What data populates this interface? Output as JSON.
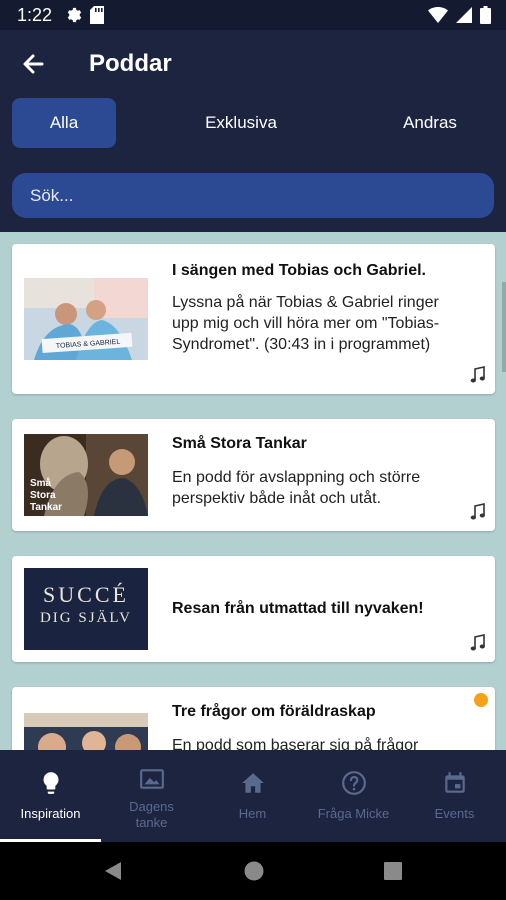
{
  "status_bar": {
    "time": "1:22",
    "left_icons": [
      "gear-icon",
      "sd-card-icon"
    ],
    "right_icons": [
      "wifi-icon",
      "signal-icon",
      "battery-icon"
    ]
  },
  "app_bar": {
    "title": "Poddar",
    "back_icon": "arrow-left-icon"
  },
  "tabs": [
    {
      "label": "Alla",
      "active": true
    },
    {
      "label": "Exklusiva",
      "active": false
    },
    {
      "label": "Andras",
      "active": false
    }
  ],
  "search": {
    "placeholder": "Sök..."
  },
  "podcasts": [
    {
      "title": "I sängen med Tobias och Gabriel.",
      "description": "Lyssna på när Tobias & Gabriel ringer upp mig och vill höra mer om \"Tobias-Syndromet\". (30:43 in i programmet)",
      "thumbnail_text": "TOBIAS & GABRIEL",
      "icon": "music-note-icon"
    },
    {
      "title": "Små Stora Tankar",
      "description": "En podd för avslappning och större perspektiv både inåt och utåt.",
      "thumbnail_text": "Små Stora Tankar",
      "icon": "music-note-icon"
    },
    {
      "title": "Resan från utmattad till nyvaken!",
      "description": "",
      "thumbnail_line1": "SUCCÉ",
      "thumbnail_line2": "DIG SJÄLV",
      "icon": "music-note-icon"
    },
    {
      "title": "Tre frågor om föräldraskap",
      "description": "En podd som baserar sig på frågor",
      "badge": "new-badge",
      "icon": "music-note-icon"
    }
  ],
  "bottom_nav": [
    {
      "label": "Inspiration",
      "icon": "lightbulb-icon",
      "active": true
    },
    {
      "label": "Dagens tanke",
      "icon": "image-icon",
      "active": false
    },
    {
      "label": "Hem",
      "icon": "home-icon",
      "active": false
    },
    {
      "label": "Fråga Micke",
      "icon": "help-circle-icon",
      "active": false
    },
    {
      "label": "Events",
      "icon": "calendar-icon",
      "active": false
    }
  ],
  "system_nav": [
    "back-triangle-icon",
    "home-circle-icon",
    "recents-square-icon"
  ],
  "colors": {
    "header_bg": "#1c2440",
    "accent": "#2b4a93",
    "content_bg": "#b2d0d0",
    "badge": "#f5a21a"
  }
}
